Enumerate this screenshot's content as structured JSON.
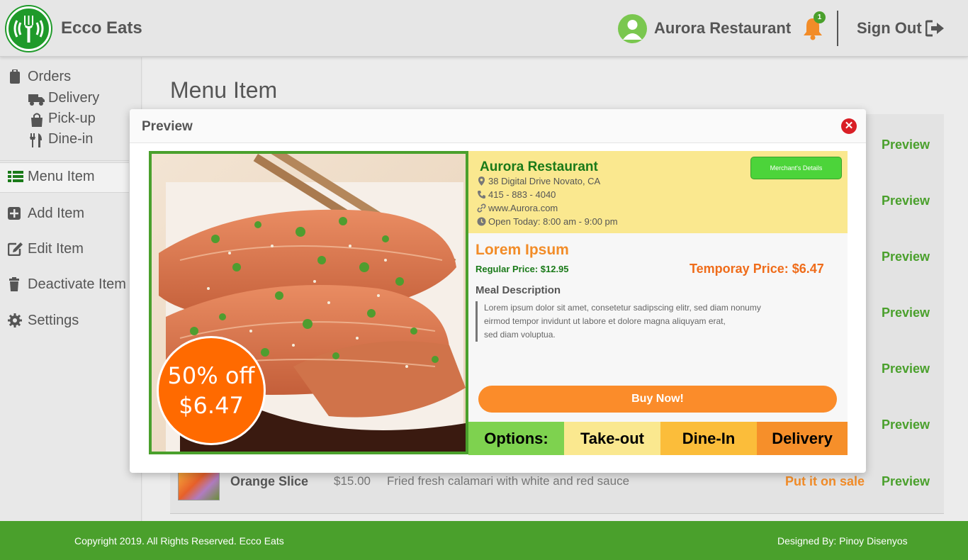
{
  "app": {
    "brand": "Ecco Eats"
  },
  "header": {
    "user_name": "Aurora Restaurant",
    "notification_count": "1",
    "signout_label": "Sign Out"
  },
  "sidebar": {
    "orders": "Orders",
    "delivery": "Delivery",
    "pickup": "Pick-up",
    "dinein": "Dine-in",
    "menu_item": "Menu Item",
    "add_item": "Add Item",
    "edit_item": "Edit Item",
    "deactivate_item": "Deactivate Item",
    "settings": "Settings"
  },
  "main": {
    "title": "Menu Item",
    "preview_link_label": "Preview",
    "row": {
      "name": "Orange Slice",
      "price": "$15.00",
      "description": "Fried fresh calamari with white and red sauce",
      "sale_label": "Put it on sale",
      "preview_label": "Preview"
    }
  },
  "modal": {
    "title": "Preview",
    "discount_pct": "50% off",
    "discount_amount": "$6.47",
    "restaurant": {
      "name": "Aurora Restaurant",
      "address": "38 Digital Drive Novato, CA",
      "phone": "415 - 883 - 4040",
      "website": "www.Aurora.com",
      "hours": "Open Today: 8:00 am - 9:00 pm",
      "merchant_button": "Merchant's Details"
    },
    "dish": {
      "name": "Lorem Ipsum",
      "regular_price": "Regular Price: $12.95",
      "temp_price": "Temporay Price: $6.47",
      "meal_heading": "Meal Description",
      "meal_line1": "Lorem ipsum dolor sit amet, consetetur sadipscing elitr, sed diam nonumy",
      "meal_line2": "eirmod tempor invidunt ut labore et dolore magna aliquyam erat,",
      "meal_line3": "sed diam voluptua.",
      "buy_label": "Buy Now!"
    },
    "options": {
      "label": "Options:",
      "takeout": "Take-out",
      "dinein": "Dine-In",
      "delivery": "Delivery"
    }
  },
  "footer": {
    "copyright": "Copyright 2019. All Rights Reserved. Ecco Eats",
    "designer": "Designed By: Pinoy Disenyos"
  },
  "colors": {
    "brand_green": "#4aa02c",
    "accent_orange": "#f28c28",
    "info_yellow": "#fae88f",
    "discount_orange": "#ff6a00"
  },
  "icons": [
    "fork-logo-icon",
    "user-avatar-icon",
    "bell-icon",
    "sign-out-icon",
    "clipboard-icon",
    "truck-icon",
    "shopping-bag-icon",
    "utensils-icon",
    "list-icon",
    "plus-square-icon",
    "edit-icon",
    "trash-icon",
    "gear-icon",
    "close-icon",
    "map-pin-icon",
    "phone-icon",
    "link-icon",
    "clock-icon"
  ]
}
